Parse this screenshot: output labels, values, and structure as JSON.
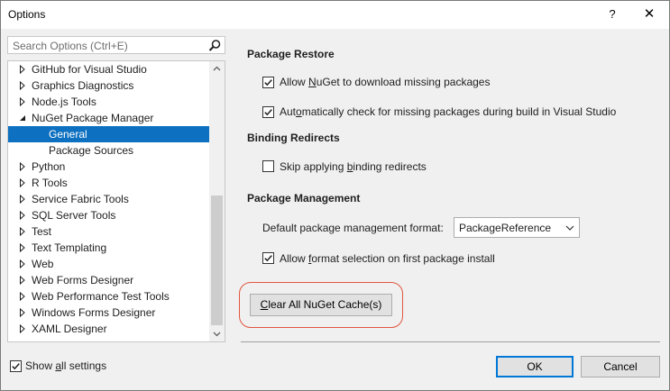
{
  "window": {
    "title": "Options",
    "help_glyph": "?",
    "close_glyph": "✕"
  },
  "search": {
    "placeholder": "Search Options (Ctrl+E)"
  },
  "tree": {
    "items": [
      {
        "label": "GitHub for Visual Studio",
        "state": "collapsed",
        "selected": false
      },
      {
        "label": "Graphics Diagnostics",
        "state": "collapsed",
        "selected": false
      },
      {
        "label": "Node.js Tools",
        "state": "collapsed",
        "selected": false
      },
      {
        "label": "NuGet Package Manager",
        "state": "expanded",
        "selected": false
      },
      {
        "label": "General",
        "state": "leaf",
        "selected": true
      },
      {
        "label": "Package Sources",
        "state": "leaf",
        "selected": false
      },
      {
        "label": "Python",
        "state": "collapsed",
        "selected": false
      },
      {
        "label": "R Tools",
        "state": "collapsed",
        "selected": false
      },
      {
        "label": "Service Fabric Tools",
        "state": "collapsed",
        "selected": false
      },
      {
        "label": "SQL Server Tools",
        "state": "collapsed",
        "selected": false
      },
      {
        "label": "Test",
        "state": "collapsed",
        "selected": false
      },
      {
        "label": "Text Templating",
        "state": "collapsed",
        "selected": false
      },
      {
        "label": "Web",
        "state": "collapsed",
        "selected": false
      },
      {
        "label": "Web Forms Designer",
        "state": "collapsed",
        "selected": false
      },
      {
        "label": "Web Performance Test Tools",
        "state": "collapsed",
        "selected": false
      },
      {
        "label": "Windows Forms Designer",
        "state": "collapsed",
        "selected": false
      },
      {
        "label": "XAML Designer",
        "state": "collapsed",
        "selected": false
      }
    ]
  },
  "package_restore": {
    "heading": "Package Restore",
    "allow_download": {
      "before": "Allow ",
      "accel": "N",
      "after": "uGet to download missing packages",
      "checked": true
    },
    "auto_check": {
      "before": "Aut",
      "accel": "o",
      "after": "matically check for missing packages during build in Visual Studio",
      "checked": true
    }
  },
  "binding_redirects": {
    "heading": "Binding Redirects",
    "skip": {
      "before": "Skip applying ",
      "accel": "b",
      "after": "inding redirects",
      "checked": false
    }
  },
  "package_management": {
    "heading": "Package Management",
    "format_label": "Default package management format:",
    "format_value": "PackageReference",
    "allow_selection": {
      "before": "Allow ",
      "accel": "f",
      "after": "ormat selection on first package install",
      "checked": true
    }
  },
  "clear_cache": {
    "accel": "C",
    "after": "lear All NuGet Cache(s)"
  },
  "footer": {
    "show_all": {
      "before": "Show ",
      "accel": "a",
      "after": "ll settings",
      "checked": true
    },
    "ok_label": "OK",
    "cancel_label": "Cancel"
  },
  "colors": {
    "selection": "#0e70c0",
    "accent_border": "#0078d7",
    "highlight_ring": "#e0563f"
  }
}
